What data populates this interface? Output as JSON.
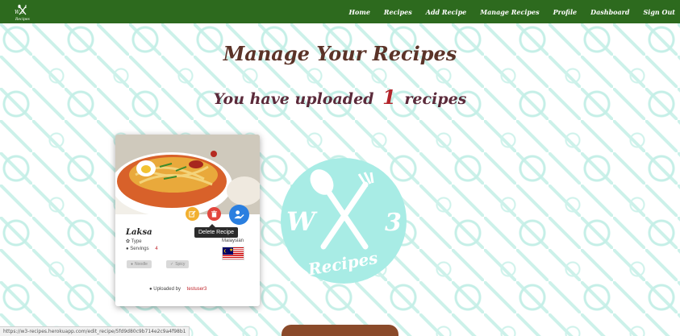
{
  "nav": {
    "brand_letters": "W 3",
    "brand_sub": "Recipes",
    "links": [
      "Home",
      "Recipes",
      "Add Recipe",
      "Manage Recipes",
      "Profile",
      "Dashboard",
      "Sign Out"
    ]
  },
  "page": {
    "title": "Manage Your Recipes",
    "uploaded_prefix": "You have uploaded",
    "uploaded_count": "1",
    "uploaded_suffix": "recipes"
  },
  "logo": {
    "letter_w": "W",
    "letter_3": "3",
    "word": "Recipes",
    "color": "#a8ece5"
  },
  "recipe_card": {
    "name": "Laksa",
    "type_label": "Type",
    "servings_label": "Servings",
    "servings": "4",
    "origin_label": "Malaysian",
    "tag_1": "Noodle",
    "tag_2": "Spicy",
    "uploaded_by_label": "Uploaded by",
    "uploader": "testuser3",
    "tooltip": "Delete Recipe"
  },
  "statusbar": {
    "url": "https://w3-recipes.herokuapp.com/edit_recipe/5fd9d80c9b714e2c9a4f98b1"
  },
  "colors": {
    "navbar": "#2d6a1e",
    "title": "#5b3328",
    "count": "#b3242a",
    "edit": "#f2b030",
    "delete": "#e2453d",
    "profile": "#2a7fe0"
  }
}
